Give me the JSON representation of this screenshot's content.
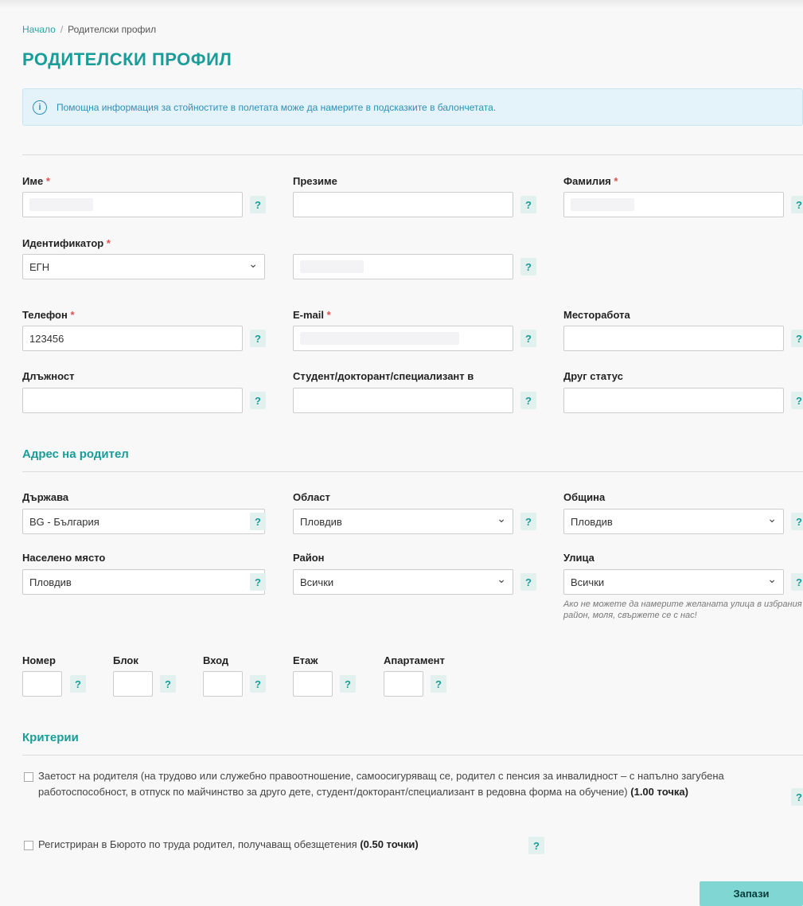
{
  "breadcrumb": {
    "home": "Начало",
    "current": "Родителски профил"
  },
  "page_title": "РОДИТЕЛСКИ ПРОФИЛ",
  "info_text": "Помощна информация за стойностите в полетата може да намерите в подсказките в балончетата.",
  "help_symbol": "?",
  "required_mark": "*",
  "fields": {
    "first_name": {
      "label": "Име",
      "value": ""
    },
    "middle_name": {
      "label": "Презиме",
      "value": ""
    },
    "last_name": {
      "label": "Фамилия",
      "value": ""
    },
    "identifier": {
      "label": "Идентификатор",
      "type_value": "ЕГН",
      "value": ""
    },
    "phone": {
      "label": "Телефон",
      "value": "123456"
    },
    "email": {
      "label": "E-mail",
      "value": ""
    },
    "workplace": {
      "label": "Месторабота",
      "value": ""
    },
    "position": {
      "label": "Длъжност",
      "value": ""
    },
    "student": {
      "label": "Студент/докторант/специализант в",
      "value": ""
    },
    "other_status": {
      "label": "Друг статус",
      "value": ""
    }
  },
  "address": {
    "title": "Адрес на родител",
    "country": {
      "label": "Държава",
      "value": "BG - България"
    },
    "region": {
      "label": "Област",
      "value": "Пловдив"
    },
    "municipality": {
      "label": "Община",
      "value": "Пловдив"
    },
    "settlement": {
      "label": "Населено място",
      "value": "Пловдив"
    },
    "district": {
      "label": "Район",
      "value": "Всички"
    },
    "street": {
      "label": "Улица",
      "value": "Всички"
    },
    "street_hint": "Ако не можете да намерите желаната улица в избрания район, моля, свържете се с нас!",
    "number": {
      "label": "Номер"
    },
    "block": {
      "label": "Блок"
    },
    "entrance": {
      "label": "Вход"
    },
    "floor": {
      "label": "Етаж"
    },
    "apartment": {
      "label": "Апартамент"
    }
  },
  "criteria": {
    "title": "Критерии",
    "item1": {
      "text": "Заетост на родителя (на трудово или служебно правоотношение, самоосигуряващ се, родител с пенсия за инвалидност – с напълно загубена работоспособност, в отпуск по майчинство за друго дете, студент/докторант/специализант в редовна форма на обучение)",
      "points": "(1.00 точка)"
    },
    "item2": {
      "text": "Регистриран в Бюрото по труда родител, получаващ обезщетения",
      "points": "(0.50 точки)"
    }
  },
  "save_label": "Запази"
}
